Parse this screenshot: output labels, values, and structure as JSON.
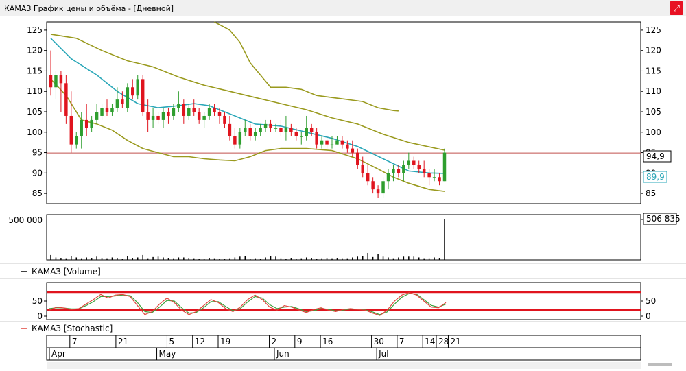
{
  "window": {
    "title": "КАМАЗ График цены и объёма - [Дневной]",
    "corner_icon": "resize-icon",
    "corner_color": "#e81123"
  },
  "colors": {
    "up": "#2e9e2e",
    "down": "#e0141e",
    "sma": "#2aa7b8",
    "bands": "#9a9a1e",
    "hline": "#c0504d",
    "stoch_k": "#e0443c",
    "stoch_d": "#3ca13c",
    "levels": "#e0141e",
    "volume": "#000000"
  },
  "panels": {
    "volume_legend": "КАМАЗ [Volume]",
    "stoch_legend": "КАМАЗ [Stochastic]"
  },
  "chart_data": [
    {
      "type": "candlestick",
      "ylim": [
        82.5,
        127
      ],
      "yticks": [
        85,
        90,
        95,
        100,
        105,
        110,
        115,
        120,
        125
      ],
      "hline": 94.9,
      "last_price_label": "94,9",
      "sma_last_label": "89,9",
      "candles": [
        [
          114,
          120,
          109,
          111
        ],
        [
          111,
          115,
          108,
          114
        ],
        [
          114,
          115,
          105,
          112
        ],
        [
          112,
          114,
          102,
          104
        ],
        [
          104,
          110,
          95,
          97
        ],
        [
          97,
          100,
          96,
          99
        ],
        [
          99,
          105,
          96,
          103
        ],
        [
          103,
          107,
          99,
          101
        ],
        [
          101,
          104,
          100,
          103
        ],
        [
          103,
          107,
          102,
          105
        ],
        [
          104,
          107,
          103,
          106
        ],
        [
          106,
          108,
          104,
          105
        ],
        [
          105,
          107,
          104,
          106
        ],
        [
          106,
          111,
          105,
          108
        ],
        [
          108,
          110,
          106,
          107
        ],
        [
          106,
          112,
          105,
          111
        ],
        [
          111,
          113,
          108,
          109
        ],
        [
          109,
          114,
          108,
          113
        ],
        [
          113,
          114,
          104,
          105
        ],
        [
          105,
          108,
          100,
          103
        ],
        [
          103,
          106,
          101,
          104
        ],
        [
          104,
          105,
          102,
          103
        ],
        [
          103,
          106,
          101,
          105
        ],
        [
          105,
          106,
          102,
          104
        ],
        [
          104,
          107,
          103,
          106
        ],
        [
          106,
          110,
          105,
          107
        ],
        [
          107,
          108,
          102,
          104
        ],
        [
          104,
          107,
          103,
          106
        ],
        [
          106,
          108,
          104,
          105
        ],
        [
          105,
          106,
          102,
          103
        ],
        [
          103,
          105,
          101,
          104
        ],
        [
          104,
          107,
          103,
          106
        ],
        [
          106,
          107,
          104,
          105
        ],
        [
          105,
          106,
          102,
          104
        ],
        [
          104,
          105,
          101,
          102
        ],
        [
          102,
          104,
          98,
          99
        ],
        [
          99,
          101,
          96,
          97
        ],
        [
          97,
          101,
          96,
          100
        ],
        [
          100,
          103,
          99,
          101
        ],
        [
          101,
          102,
          98,
          99
        ],
        [
          99,
          101,
          98,
          100
        ],
        [
          100,
          102,
          99,
          101
        ],
        [
          101,
          103,
          100,
          102
        ],
        [
          102,
          103,
          100,
          101
        ],
        [
          101,
          102,
          100,
          101
        ],
        [
          101,
          103,
          99,
          100
        ],
        [
          100,
          104,
          98,
          101
        ],
        [
          101,
          102,
          99,
          100
        ],
        [
          100,
          101,
          98,
          99
        ],
        [
          99,
          100,
          97,
          99
        ],
        [
          99,
          104,
          98,
          101
        ],
        [
          101,
          102,
          99,
          100
        ],
        [
          100,
          101,
          96,
          97
        ],
        [
          97,
          99,
          96,
          98
        ],
        [
          98,
          99,
          96,
          97
        ],
        [
          97,
          99,
          96,
          97
        ],
        [
          97,
          99,
          97,
          98
        ],
        [
          98,
          99,
          96,
          97
        ],
        [
          97,
          98,
          95,
          96
        ],
        [
          96,
          98,
          94,
          95
        ],
        [
          95,
          96,
          91,
          92
        ],
        [
          92,
          94,
          89,
          90
        ],
        [
          90,
          92,
          87,
          88
        ],
        [
          88,
          89,
          85,
          86
        ],
        [
          86,
          87,
          84,
          85
        ],
        [
          85,
          89,
          84,
          88
        ],
        [
          88,
          91,
          86,
          90
        ],
        [
          90,
          92,
          88,
          91
        ],
        [
          91,
          92,
          89,
          90
        ],
        [
          90,
          93,
          88,
          92
        ],
        [
          92,
          95,
          91,
          93
        ],
        [
          93,
          94,
          91,
          92
        ],
        [
          92,
          93,
          90,
          91
        ],
        [
          91,
          93,
          89,
          90
        ],
        [
          90,
          91,
          87,
          89
        ],
        [
          89,
          91,
          88,
          89
        ],
        [
          89,
          90,
          87,
          88
        ],
        [
          88,
          96,
          88,
          95
        ]
      ],
      "sma": [
        [
          0,
          123
        ],
        [
          4,
          118
        ],
        [
          9,
          114
        ],
        [
          13,
          110
        ],
        [
          17,
          107
        ],
        [
          21,
          106
        ],
        [
          25,
          106.5
        ],
        [
          28,
          107
        ],
        [
          31,
          106.5
        ],
        [
          36,
          104
        ],
        [
          40,
          102
        ],
        [
          45,
          101.5
        ],
        [
          50,
          100
        ],
        [
          55,
          98.5
        ],
        [
          60,
          96.5
        ],
        [
          65,
          93.5
        ],
        [
          70,
          90.5
        ],
        [
          74,
          90
        ],
        [
          77,
          89.9
        ]
      ],
      "bb_upper": [
        [
          0,
          124
        ],
        [
          5,
          123
        ],
        [
          10,
          120
        ],
        [
          15,
          117.5
        ],
        [
          20,
          116
        ],
        [
          25,
          113.5
        ],
        [
          30,
          111.5
        ],
        [
          35,
          110
        ],
        [
          40,
          108.5
        ],
        [
          45,
          107
        ],
        [
          50,
          105.5
        ],
        [
          55,
          103.5
        ],
        [
          60,
          102
        ],
        [
          65,
          99.5
        ],
        [
          70,
          97.5
        ],
        [
          77,
          95.6
        ]
      ],
      "bb_lower": [
        [
          0,
          113
        ],
        [
          3,
          109
        ],
        [
          6,
          103
        ],
        [
          9,
          102
        ],
        [
          12,
          100.5
        ],
        [
          15,
          98
        ],
        [
          18,
          96
        ],
        [
          21,
          95
        ],
        [
          24,
          94
        ],
        [
          27,
          94
        ],
        [
          30,
          93.5
        ],
        [
          33,
          93.2
        ],
        [
          36,
          93
        ],
        [
          39,
          94
        ],
        [
          42,
          95.5
        ],
        [
          45,
          96
        ],
        [
          50,
          96
        ],
        [
          55,
          95.5
        ],
        [
          60,
          93.5
        ],
        [
          64,
          91
        ],
        [
          67,
          89
        ],
        [
          70,
          87.5
        ],
        [
          74,
          86
        ],
        [
          77,
          85.5
        ]
      ],
      "bb_outer": [
        [
          32,
          127
        ],
        [
          35,
          125
        ],
        [
          37,
          122
        ],
        [
          39,
          117
        ],
        [
          41,
          114
        ],
        [
          43,
          111
        ],
        [
          46,
          111
        ],
        [
          49,
          110.5
        ],
        [
          52,
          109
        ],
        [
          55,
          108.5
        ],
        [
          58,
          108
        ],
        [
          61,
          107.5
        ],
        [
          64,
          106
        ],
        [
          67,
          105.3
        ],
        [
          68,
          105.2
        ]
      ]
    },
    {
      "type": "bar",
      "title": "КАМАЗ [Volume]",
      "ylim": [
        0,
        500000
      ],
      "yticks": [
        "500 000"
      ],
      "last_label": "506 835",
      "values": [
        60000,
        30000,
        25000,
        20000,
        45000,
        30000,
        20000,
        30000,
        25000,
        40000,
        25000,
        20000,
        30000,
        25000,
        15000,
        50000,
        25000,
        30000,
        60000,
        20000,
        35000,
        40000,
        30000,
        25000,
        20000,
        30000,
        30000,
        25000,
        20000,
        10000,
        15000,
        25000,
        20000,
        15000,
        10000,
        20000,
        30000,
        40000,
        45000,
        15000,
        20000,
        15000,
        30000,
        45000,
        40000,
        20000,
        15000,
        25000,
        15000,
        20000,
        30000,
        25000,
        15000,
        20000,
        25000,
        20000,
        25000,
        20000,
        20000,
        30000,
        40000,
        50000,
        85000,
        35000,
        70000,
        40000,
        30000,
        20000,
        30000,
        40000,
        40000,
        40000,
        30000,
        20000,
        20000,
        30000,
        25000,
        500000
      ]
    },
    {
      "type": "line",
      "title": "КАМАЗ [Stochastic]",
      "ylim": [
        0,
        100
      ],
      "yticks": [
        0,
        50
      ],
      "levels": [
        80,
        20
      ],
      "k": [
        [
          0,
          20
        ],
        [
          2,
          30
        ],
        [
          4,
          27
        ],
        [
          6,
          22
        ],
        [
          8,
          25
        ],
        [
          10,
          40
        ],
        [
          12,
          55
        ],
        [
          14,
          72
        ],
        [
          16,
          60
        ],
        [
          18,
          70
        ],
        [
          20,
          72
        ],
        [
          22,
          65
        ],
        [
          24,
          35
        ],
        [
          26,
          5
        ],
        [
          28,
          15
        ],
        [
          30,
          40
        ],
        [
          32,
          60
        ],
        [
          34,
          45
        ],
        [
          36,
          20
        ],
        [
          38,
          5
        ],
        [
          40,
          15
        ],
        [
          42,
          35
        ],
        [
          44,
          55
        ],
        [
          46,
          45
        ],
        [
          48,
          25
        ],
        [
          50,
          15
        ],
        [
          52,
          30
        ],
        [
          54,
          55
        ],
        [
          56,
          70
        ],
        [
          58,
          55
        ],
        [
          60,
          30
        ],
        [
          62,
          20
        ],
        [
          64,
          35
        ],
        [
          66,
          30
        ],
        [
          68,
          20
        ],
        [
          70,
          12
        ],
        [
          72,
          22
        ],
        [
          74,
          28
        ],
        [
          76,
          20
        ],
        [
          78,
          15
        ],
        [
          80,
          22
        ],
        [
          82,
          25
        ],
        [
          84,
          22
        ],
        [
          86,
          20
        ],
        [
          88,
          10
        ],
        [
          90,
          2
        ],
        [
          92,
          20
        ],
        [
          94,
          50
        ],
        [
          96,
          70
        ],
        [
          98,
          78
        ],
        [
          100,
          70
        ],
        [
          102,
          50
        ],
        [
          104,
          30
        ],
        [
          106,
          28
        ],
        [
          108,
          45
        ]
      ],
      "d": [
        [
          0,
          25
        ],
        [
          2,
          28
        ],
        [
          4,
          27
        ],
        [
          6,
          24
        ],
        [
          8,
          24
        ],
        [
          10,
          35
        ],
        [
          12,
          48
        ],
        [
          14,
          65
        ],
        [
          16,
          65
        ],
        [
          18,
          67
        ],
        [
          20,
          70
        ],
        [
          22,
          68
        ],
        [
          24,
          45
        ],
        [
          26,
          15
        ],
        [
          28,
          12
        ],
        [
          30,
          30
        ],
        [
          32,
          52
        ],
        [
          34,
          50
        ],
        [
          36,
          28
        ],
        [
          38,
          10
        ],
        [
          40,
          12
        ],
        [
          42,
          28
        ],
        [
          44,
          48
        ],
        [
          46,
          48
        ],
        [
          48,
          32
        ],
        [
          50,
          18
        ],
        [
          52,
          25
        ],
        [
          54,
          47
        ],
        [
          56,
          65
        ],
        [
          58,
          60
        ],
        [
          60,
          38
        ],
        [
          62,
          25
        ],
        [
          64,
          30
        ],
        [
          66,
          32
        ],
        [
          68,
          24
        ],
        [
          70,
          15
        ],
        [
          72,
          18
        ],
        [
          74,
          25
        ],
        [
          76,
          23
        ],
        [
          78,
          17
        ],
        [
          80,
          20
        ],
        [
          82,
          24
        ],
        [
          84,
          23
        ],
        [
          86,
          21
        ],
        [
          88,
          14
        ],
        [
          90,
          5
        ],
        [
          92,
          14
        ],
        [
          94,
          40
        ],
        [
          96,
          63
        ],
        [
          98,
          75
        ],
        [
          100,
          73
        ],
        [
          102,
          55
        ],
        [
          104,
          36
        ],
        [
          106,
          30
        ],
        [
          108,
          40
        ]
      ]
    },
    {
      "type": "time_axis",
      "days": [
        {
          "label": "7",
          "idx": 4
        },
        {
          "label": "21",
          "idx": 13
        },
        {
          "label": "5",
          "idx": 23
        },
        {
          "label": "12",
          "idx": 28
        },
        {
          "label": "19",
          "idx": 33
        },
        {
          "label": "2",
          "idx": 43
        },
        {
          "label": "9",
          "idx": 48
        },
        {
          "label": "16",
          "idx": 53
        },
        {
          "label": "30",
          "idx": 63
        },
        {
          "label": "7",
          "idx": 68
        },
        {
          "label": "14",
          "idx": 73
        },
        {
          "label": "21",
          "idx": 78
        },
        {
          "label": "28",
          "idx": 77
        }
      ],
      "months": [
        {
          "label": "Apr",
          "idx": 0
        },
        {
          "label": "May",
          "idx": 21
        },
        {
          "label": "Jun",
          "idx": 44
        },
        {
          "label": "Jul",
          "idx": 64
        }
      ]
    }
  ]
}
